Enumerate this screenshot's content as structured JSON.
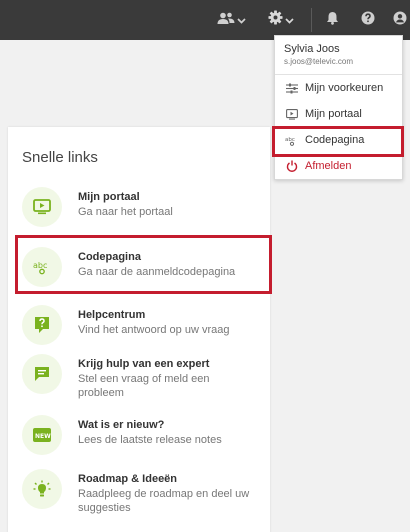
{
  "topbar": {
    "icons": [
      "people-icon",
      "gear-icon",
      "bell-icon",
      "help-icon",
      "user-icon"
    ],
    "background": "#3a3a3a"
  },
  "quick_links": {
    "title": "Snelle links",
    "items": [
      {
        "icon": "portal-play-icon",
        "title": "Mijn portaal",
        "subtitle": "Ga naar het portaal"
      },
      {
        "icon": "abc-code-icon",
        "title": "Codepagina",
        "subtitle": "Ga naar de aanmeldcodepagina"
      },
      {
        "icon": "help-question-icon",
        "title": "Helpcentrum",
        "subtitle": "Vind het antwoord op uw vraag"
      },
      {
        "icon": "chat-icon",
        "title": "Krijg hulp van een expert",
        "subtitle": "Stel een vraag of meld een probleem"
      },
      {
        "icon": "new-badge-icon",
        "title": "Wat is er nieuw?",
        "subtitle": "Lees de laatste release notes"
      },
      {
        "icon": "lightbulb-icon",
        "title": "Roadmap & Ideeën",
        "subtitle": "Raadpleeg de roadmap en deel uw suggesties"
      }
    ]
  },
  "user_menu": {
    "name": "Sylvia Joos",
    "email": "s.joos@televic.com",
    "items": [
      {
        "icon": "sliders-icon",
        "label": "Mijn voorkeuren"
      },
      {
        "icon": "portal-play-icon",
        "label": "Mijn portaal"
      },
      {
        "icon": "abc-code-icon",
        "label": "Codepagina"
      },
      {
        "icon": "power-icon",
        "label": "Afmelden"
      }
    ]
  },
  "colors": {
    "accent_green": "#7ab21f",
    "highlight_red": "#c41d2e",
    "icon_bg": "#f1f8e6"
  }
}
